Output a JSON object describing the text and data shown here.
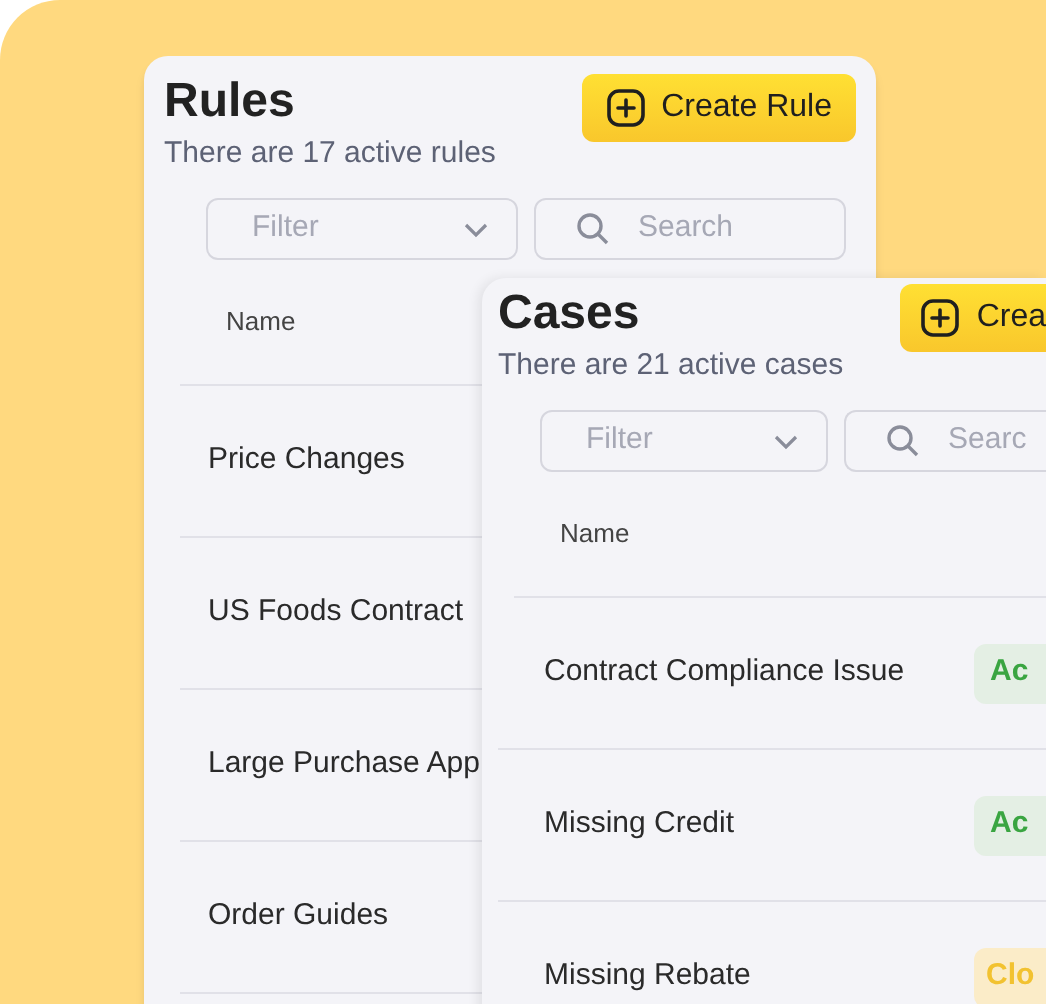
{
  "rules_panel": {
    "title": "Rules",
    "subtitle": "There are 17 active rules",
    "create_button": "Create Rule",
    "filter": {
      "placeholder": "Filter"
    },
    "search": {
      "placeholder": "Search"
    },
    "column": "Name",
    "rows": [
      {
        "name": "Price Changes"
      },
      {
        "name": "US Foods Contract"
      },
      {
        "name": "Large Purchase App"
      },
      {
        "name": "Order Guides"
      }
    ]
  },
  "cases_panel": {
    "title": "Cases",
    "subtitle": "There are 21 active cases",
    "create_button": "Crea",
    "filter": {
      "placeholder": "Filter"
    },
    "search": {
      "placeholder": "Searc"
    },
    "column": "Name",
    "rows": [
      {
        "name": "Contract Compliance Issue",
        "status": "Ac",
        "kind": "active"
      },
      {
        "name": "Missing Credit",
        "status": "Ac",
        "kind": "active"
      },
      {
        "name": "Missing Rebate",
        "status": "Clo",
        "kind": "closed"
      }
    ]
  }
}
